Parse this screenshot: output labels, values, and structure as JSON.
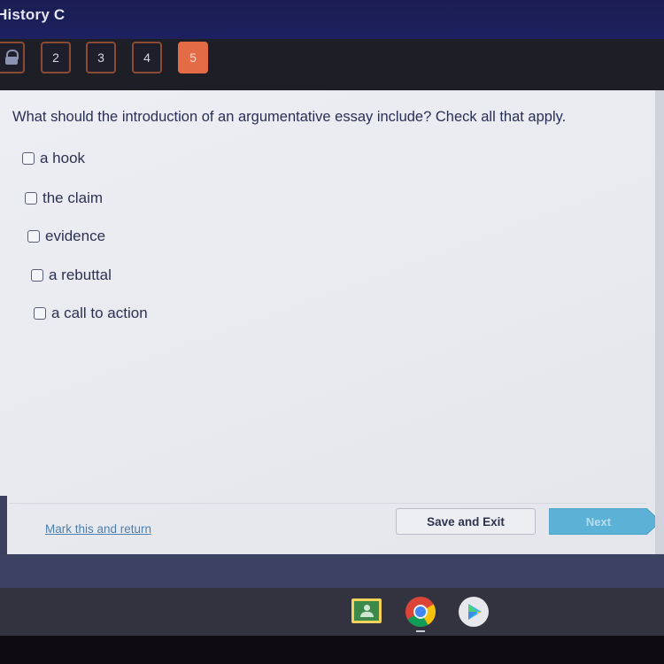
{
  "header": {
    "title": "History C"
  },
  "question_nav": {
    "tabs": [
      {
        "label": "",
        "icon": "lock-icon",
        "state": "locked"
      },
      {
        "label": "2",
        "state": "default"
      },
      {
        "label": "3",
        "state": "default"
      },
      {
        "label": "4",
        "state": "default"
      },
      {
        "label": "5",
        "state": "active"
      }
    ],
    "active_color": "#e36b45"
  },
  "question": {
    "prompt": "What should the introduction of an argumentative essay include? Check all that apply.",
    "options": [
      {
        "label": "a hook",
        "checked": false
      },
      {
        "label": "the claim",
        "checked": false
      },
      {
        "label": "evidence",
        "checked": false
      },
      {
        "label": "a rebuttal",
        "checked": false
      },
      {
        "label": "a call to action",
        "checked": false
      }
    ]
  },
  "footer": {
    "mark_link": "Mark this and return",
    "save_exit_label": "Save and Exit",
    "next_label": "Next",
    "next_color": "#5bb2d6"
  },
  "shelf": {
    "apps": [
      {
        "name": "Google Classroom",
        "icon": "classroom-icon"
      },
      {
        "name": "Chrome",
        "icon": "chrome-icon",
        "active": true
      },
      {
        "name": "Play Store",
        "icon": "play-store-icon"
      }
    ]
  }
}
